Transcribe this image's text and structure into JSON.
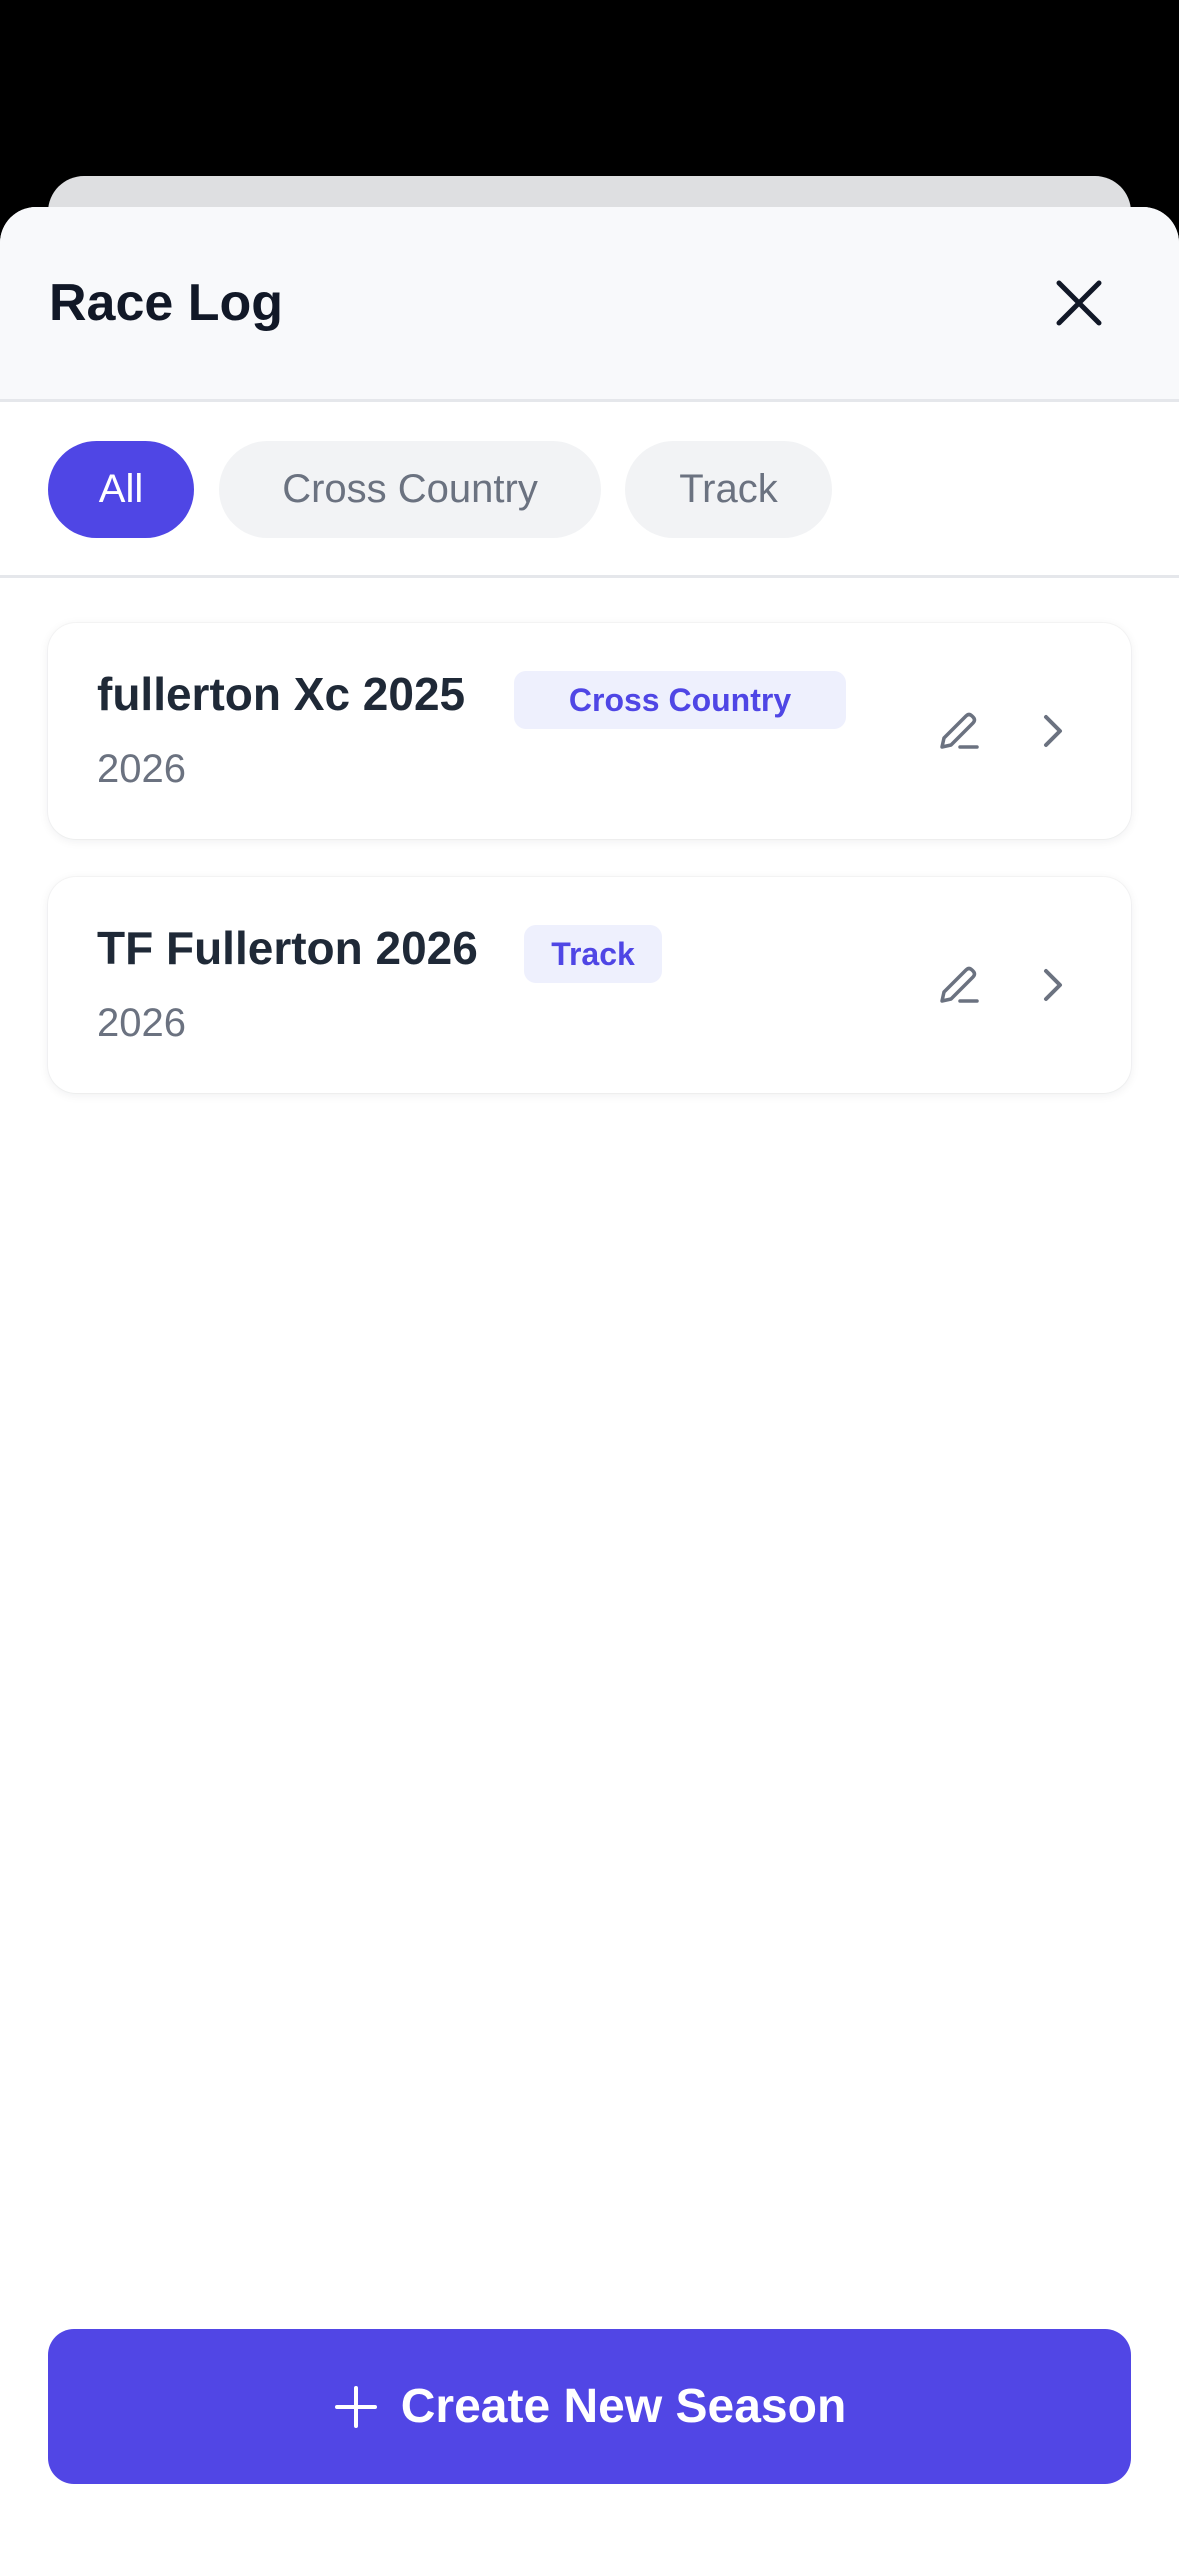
{
  "header": {
    "title": "Race Log",
    "close_icon": "close-icon"
  },
  "filters": [
    {
      "label": "All",
      "active": true
    },
    {
      "label": "Cross Country",
      "active": false
    },
    {
      "label": "Track",
      "active": false
    }
  ],
  "seasons": [
    {
      "name": "fullerton Xc 2025",
      "type": "Cross Country",
      "year": "2026",
      "edit_icon": "pencil-icon",
      "open_icon": "chevron-right-icon"
    },
    {
      "name": "TF Fullerton 2026",
      "type": "Track",
      "year": "2026",
      "edit_icon": "pencil-icon",
      "open_icon": "chevron-right-icon"
    }
  ],
  "footer": {
    "create_label": "Create New Season",
    "create_icon": "plus-icon"
  },
  "colors": {
    "accent": "#4f46e5",
    "badge_bg": "#eef0fd",
    "text_primary": "#111827",
    "text_secondary": "#6b7280"
  }
}
